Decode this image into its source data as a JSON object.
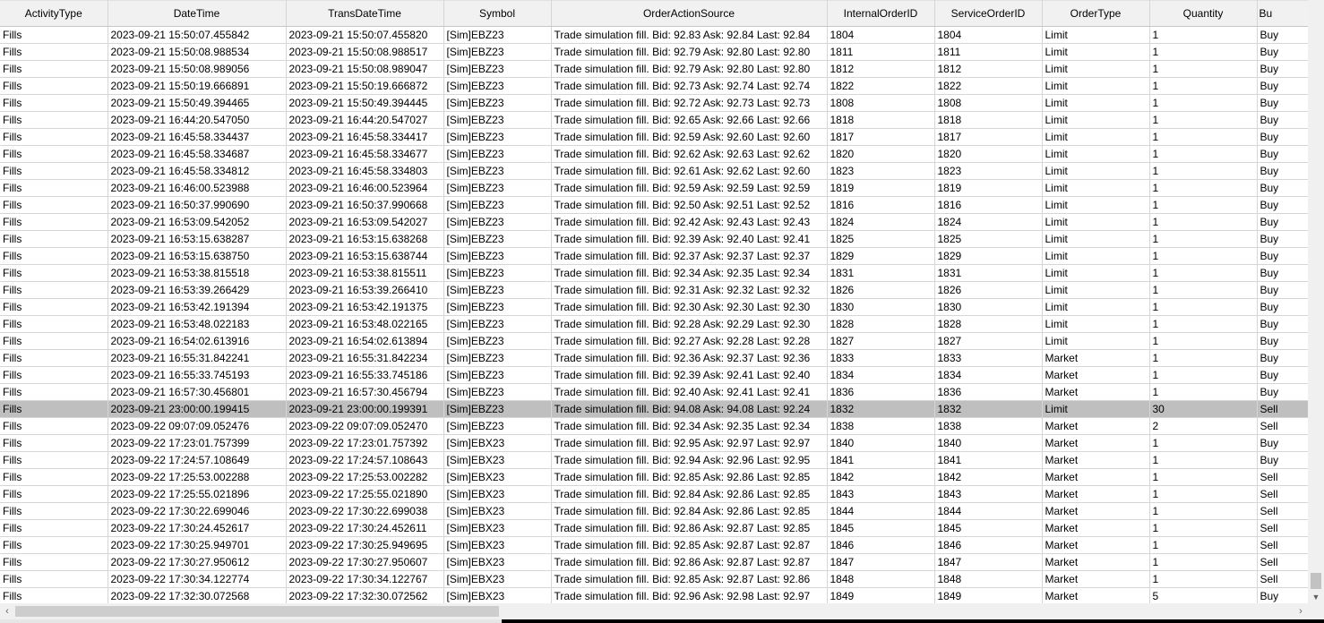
{
  "columns": [
    "ActivityType",
    "DateTime",
    "TransDateTime",
    "Symbol",
    "OrderActionSource",
    "InternalOrderID",
    "ServiceOrderID",
    "OrderType",
    "Quantity",
    "Bu"
  ],
  "selected_row": 22,
  "rows": [
    [
      "Fills",
      "2023-09-21  15:50:07.455842",
      "2023-09-21  15:50:07.455820",
      "[Sim]EBZ23",
      "Trade simulation fill. Bid: 92.83 Ask: 92.84 Last: 92.84",
      "1804",
      "1804",
      "Limit",
      "1",
      "Buy"
    ],
    [
      "Fills",
      "2023-09-21  15:50:08.988534",
      "2023-09-21  15:50:08.988517",
      "[Sim]EBZ23",
      "Trade simulation fill. Bid: 92.79 Ask: 92.80 Last: 92.80",
      "1811",
      "1811",
      "Limit",
      "1",
      "Buy"
    ],
    [
      "Fills",
      "2023-09-21  15:50:08.989056",
      "2023-09-21  15:50:08.989047",
      "[Sim]EBZ23",
      "Trade simulation fill. Bid: 92.79 Ask: 92.80 Last: 92.80",
      "1812",
      "1812",
      "Limit",
      "1",
      "Buy"
    ],
    [
      "Fills",
      "2023-09-21  15:50:19.666891",
      "2023-09-21  15:50:19.666872",
      "[Sim]EBZ23",
      "Trade simulation fill. Bid: 92.73 Ask: 92.74 Last: 92.74",
      "1822",
      "1822",
      "Limit",
      "1",
      "Buy"
    ],
    [
      "Fills",
      "2023-09-21  15:50:49.394465",
      "2023-09-21  15:50:49.394445",
      "[Sim]EBZ23",
      "Trade simulation fill. Bid: 92.72 Ask: 92.73 Last: 92.73",
      "1808",
      "1808",
      "Limit",
      "1",
      "Buy"
    ],
    [
      "Fills",
      "2023-09-21  16:44:20.547050",
      "2023-09-21  16:44:20.547027",
      "[Sim]EBZ23",
      "Trade simulation fill. Bid: 92.65 Ask: 92.66 Last: 92.66",
      "1818",
      "1818",
      "Limit",
      "1",
      "Buy"
    ],
    [
      "Fills",
      "2023-09-21  16:45:58.334437",
      "2023-09-21  16:45:58.334417",
      "[Sim]EBZ23",
      "Trade simulation fill. Bid: 92.59 Ask: 92.60 Last: 92.60",
      "1817",
      "1817",
      "Limit",
      "1",
      "Buy"
    ],
    [
      "Fills",
      "2023-09-21  16:45:58.334687",
      "2023-09-21  16:45:58.334677",
      "[Sim]EBZ23",
      "Trade simulation fill. Bid: 92.62 Ask: 92.63 Last: 92.62",
      "1820",
      "1820",
      "Limit",
      "1",
      "Buy"
    ],
    [
      "Fills",
      "2023-09-21  16:45:58.334812",
      "2023-09-21  16:45:58.334803",
      "[Sim]EBZ23",
      "Trade simulation fill. Bid: 92.61 Ask: 92.62 Last: 92.60",
      "1823",
      "1823",
      "Limit",
      "1",
      "Buy"
    ],
    [
      "Fills",
      "2023-09-21  16:46:00.523988",
      "2023-09-21  16:46:00.523964",
      "[Sim]EBZ23",
      "Trade simulation fill. Bid: 92.59 Ask: 92.59 Last: 92.59",
      "1819",
      "1819",
      "Limit",
      "1",
      "Buy"
    ],
    [
      "Fills",
      "2023-09-21  16:50:37.990690",
      "2023-09-21  16:50:37.990668",
      "[Sim]EBZ23",
      "Trade simulation fill. Bid: 92.50 Ask: 92.51 Last: 92.52",
      "1816",
      "1816",
      "Limit",
      "1",
      "Buy"
    ],
    [
      "Fills",
      "2023-09-21  16:53:09.542052",
      "2023-09-21  16:53:09.542027",
      "[Sim]EBZ23",
      "Trade simulation fill. Bid: 92.42 Ask: 92.43 Last: 92.43",
      "1824",
      "1824",
      "Limit",
      "1",
      "Buy"
    ],
    [
      "Fills",
      "2023-09-21  16:53:15.638287",
      "2023-09-21  16:53:15.638268",
      "[Sim]EBZ23",
      "Trade simulation fill. Bid: 92.39 Ask: 92.40 Last: 92.41",
      "1825",
      "1825",
      "Limit",
      "1",
      "Buy"
    ],
    [
      "Fills",
      "2023-09-21  16:53:15.638750",
      "2023-09-21  16:53:15.638744",
      "[Sim]EBZ23",
      "Trade simulation fill. Bid: 92.37 Ask: 92.37 Last: 92.37",
      "1829",
      "1829",
      "Limit",
      "1",
      "Buy"
    ],
    [
      "Fills",
      "2023-09-21  16:53:38.815518",
      "2023-09-21  16:53:38.815511",
      "[Sim]EBZ23",
      "Trade simulation fill. Bid: 92.34 Ask: 92.35 Last: 92.34",
      "1831",
      "1831",
      "Limit",
      "1",
      "Buy"
    ],
    [
      "Fills",
      "2023-09-21  16:53:39.266429",
      "2023-09-21  16:53:39.266410",
      "[Sim]EBZ23",
      "Trade simulation fill. Bid: 92.31 Ask: 92.32 Last: 92.32",
      "1826",
      "1826",
      "Limit",
      "1",
      "Buy"
    ],
    [
      "Fills",
      "2023-09-21  16:53:42.191394",
      "2023-09-21  16:53:42.191375",
      "[Sim]EBZ23",
      "Trade simulation fill. Bid: 92.30 Ask: 92.30 Last: 92.30",
      "1830",
      "1830",
      "Limit",
      "1",
      "Buy"
    ],
    [
      "Fills",
      "2023-09-21  16:53:48.022183",
      "2023-09-21  16:53:48.022165",
      "[Sim]EBZ23",
      "Trade simulation fill. Bid: 92.28 Ask: 92.29 Last: 92.30",
      "1828",
      "1828",
      "Limit",
      "1",
      "Buy"
    ],
    [
      "Fills",
      "2023-09-21  16:54:02.613916",
      "2023-09-21  16:54:02.613894",
      "[Sim]EBZ23",
      "Trade simulation fill. Bid: 92.27 Ask: 92.28 Last: 92.28",
      "1827",
      "1827",
      "Limit",
      "1",
      "Buy"
    ],
    [
      "Fills",
      "2023-09-21  16:55:31.842241",
      "2023-09-21  16:55:31.842234",
      "[Sim]EBZ23",
      "Trade simulation fill. Bid: 92.36 Ask: 92.37 Last: 92.36",
      "1833",
      "1833",
      "Market",
      "1",
      "Buy"
    ],
    [
      "Fills",
      "2023-09-21  16:55:33.745193",
      "2023-09-21  16:55:33.745186",
      "[Sim]EBZ23",
      "Trade simulation fill. Bid: 92.39 Ask: 92.41 Last: 92.40",
      "1834",
      "1834",
      "Market",
      "1",
      "Buy"
    ],
    [
      "Fills",
      "2023-09-21  16:57:30.456801",
      "2023-09-21  16:57:30.456794",
      "[Sim]EBZ23",
      "Trade simulation fill. Bid: 92.40 Ask: 92.41 Last: 92.41",
      "1836",
      "1836",
      "Market",
      "1",
      "Buy"
    ],
    [
      "Fills",
      "2023-09-21  23:00:00.199415",
      "2023-09-21  23:00:00.199391",
      "[Sim]EBZ23",
      "Trade simulation fill. Bid: 94.08 Ask: 94.08 Last: 92.24",
      "1832",
      "1832",
      "Limit",
      "30",
      "Sell"
    ],
    [
      "Fills",
      "2023-09-22  09:07:09.052476",
      "2023-09-22  09:07:09.052470",
      "[Sim]EBZ23",
      "Trade simulation fill. Bid: 92.34 Ask: 92.35 Last: 92.34",
      "1838",
      "1838",
      "Market",
      "2",
      "Sell"
    ],
    [
      "Fills",
      "2023-09-22  17:23:01.757399",
      "2023-09-22  17:23:01.757392",
      "[Sim]EBX23",
      "Trade simulation fill. Bid: 92.95 Ask: 92.97 Last: 92.97",
      "1840",
      "1840",
      "Market",
      "1",
      "Buy"
    ],
    [
      "Fills",
      "2023-09-22  17:24:57.108649",
      "2023-09-22  17:24:57.108643",
      "[Sim]EBX23",
      "Trade simulation fill. Bid: 92.94 Ask: 92.96 Last: 92.95",
      "1841",
      "1841",
      "Market",
      "1",
      "Buy"
    ],
    [
      "Fills",
      "2023-09-22  17:25:53.002288",
      "2023-09-22  17:25:53.002282",
      "[Sim]EBX23",
      "Trade simulation fill. Bid: 92.85 Ask: 92.86 Last: 92.85",
      "1842",
      "1842",
      "Market",
      "1",
      "Sell"
    ],
    [
      "Fills",
      "2023-09-22  17:25:55.021896",
      "2023-09-22  17:25:55.021890",
      "[Sim]EBX23",
      "Trade simulation fill. Bid: 92.84 Ask: 92.86 Last: 92.85",
      "1843",
      "1843",
      "Market",
      "1",
      "Sell"
    ],
    [
      "Fills",
      "2023-09-22  17:30:22.699046",
      "2023-09-22  17:30:22.699038",
      "[Sim]EBX23",
      "Trade simulation fill. Bid: 92.84 Ask: 92.86 Last: 92.85",
      "1844",
      "1844",
      "Market",
      "1",
      "Sell"
    ],
    [
      "Fills",
      "2023-09-22  17:30:24.452617",
      "2023-09-22  17:30:24.452611",
      "[Sim]EBX23",
      "Trade simulation fill. Bid: 92.86 Ask: 92.87 Last: 92.85",
      "1845",
      "1845",
      "Market",
      "1",
      "Sell"
    ],
    [
      "Fills",
      "2023-09-22  17:30:25.949701",
      "2023-09-22  17:30:25.949695",
      "[Sim]EBX23",
      "Trade simulation fill. Bid: 92.85 Ask: 92.87 Last: 92.87",
      "1846",
      "1846",
      "Market",
      "1",
      "Sell"
    ],
    [
      "Fills",
      "2023-09-22  17:30:27.950612",
      "2023-09-22  17:30:27.950607",
      "[Sim]EBX23",
      "Trade simulation fill. Bid: 92.86 Ask: 92.87 Last: 92.87",
      "1847",
      "1847",
      "Market",
      "1",
      "Sell"
    ],
    [
      "Fills",
      "2023-09-22  17:30:34.122774",
      "2023-09-22  17:30:34.122767",
      "[Sim]EBX23",
      "Trade simulation fill. Bid: 92.85 Ask: 92.87 Last: 92.86",
      "1848",
      "1848",
      "Market",
      "1",
      "Sell"
    ],
    [
      "Fills",
      "2023-09-22  17:32:30.072568",
      "2023-09-22  17:32:30.072562",
      "[Sim]EBX23",
      "Trade simulation fill. Bid: 92.96 Ask: 92.98 Last: 92.97",
      "1849",
      "1849",
      "Market",
      "5",
      "Buy"
    ]
  ],
  "icons": {
    "scroll_left": "‹",
    "scroll_right": "›",
    "scroll_down": "▼"
  }
}
